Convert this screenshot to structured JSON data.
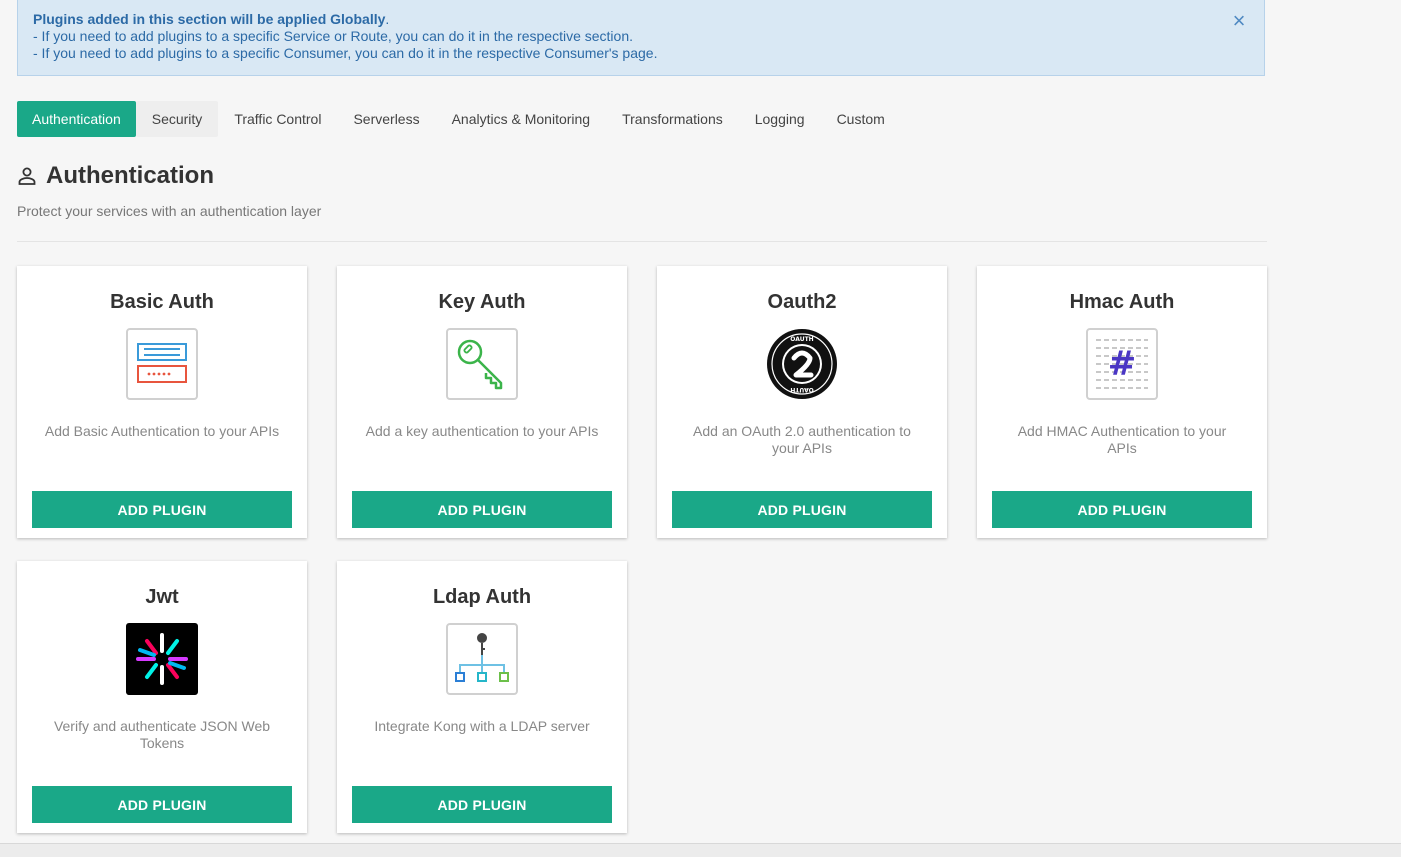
{
  "alert": {
    "headline": "Plugins added in this section will be applied Globally",
    "headline_suffix": ".",
    "line1": "- If you need to add plugins to a specific Service or Route, you can do it in the respective section.",
    "line2": "- If you need to add plugins to a specific Consumer, you can do it in the respective Consumer's page.",
    "close": "×"
  },
  "tabs": [
    {
      "label": "Authentication",
      "active": true
    },
    {
      "label": "Security"
    },
    {
      "label": "Traffic Control"
    },
    {
      "label": "Serverless"
    },
    {
      "label": "Analytics & Monitoring"
    },
    {
      "label": "Transformations"
    },
    {
      "label": "Logging"
    },
    {
      "label": "Custom"
    }
  ],
  "section": {
    "title": "Authentication",
    "subtitle": "Protect your services with an authentication layer",
    "icon": "user-icon"
  },
  "plugins": [
    {
      "title": "Basic Auth",
      "description": "Add Basic Authentication to your APIs",
      "button": "ADD PLUGIN",
      "icon": "login-form-icon"
    },
    {
      "title": "Key Auth",
      "description": "Add a key authentication to your APIs",
      "button": "ADD PLUGIN",
      "icon": "key-icon"
    },
    {
      "title": "Oauth2",
      "description": "Add an OAuth 2.0 authentication to your APIs",
      "button": "ADD PLUGIN",
      "icon": "oauth2-icon"
    },
    {
      "title": "Hmac Auth",
      "description": "Add HMAC Authentication to your APIs",
      "button": "ADD PLUGIN",
      "icon": "hash-icon"
    },
    {
      "title": "Jwt",
      "description": "Verify and authenticate JSON Web Tokens",
      "button": "ADD PLUGIN",
      "icon": "jwt-icon"
    },
    {
      "title": "Ldap Auth",
      "description": "Integrate Kong with a LDAP server",
      "button": "ADD PLUGIN",
      "icon": "ldap-tree-icon"
    }
  ],
  "colors": {
    "accent": "#1aa888",
    "alert_bg": "#d9e8f4",
    "alert_text": "#2c6aa6"
  }
}
